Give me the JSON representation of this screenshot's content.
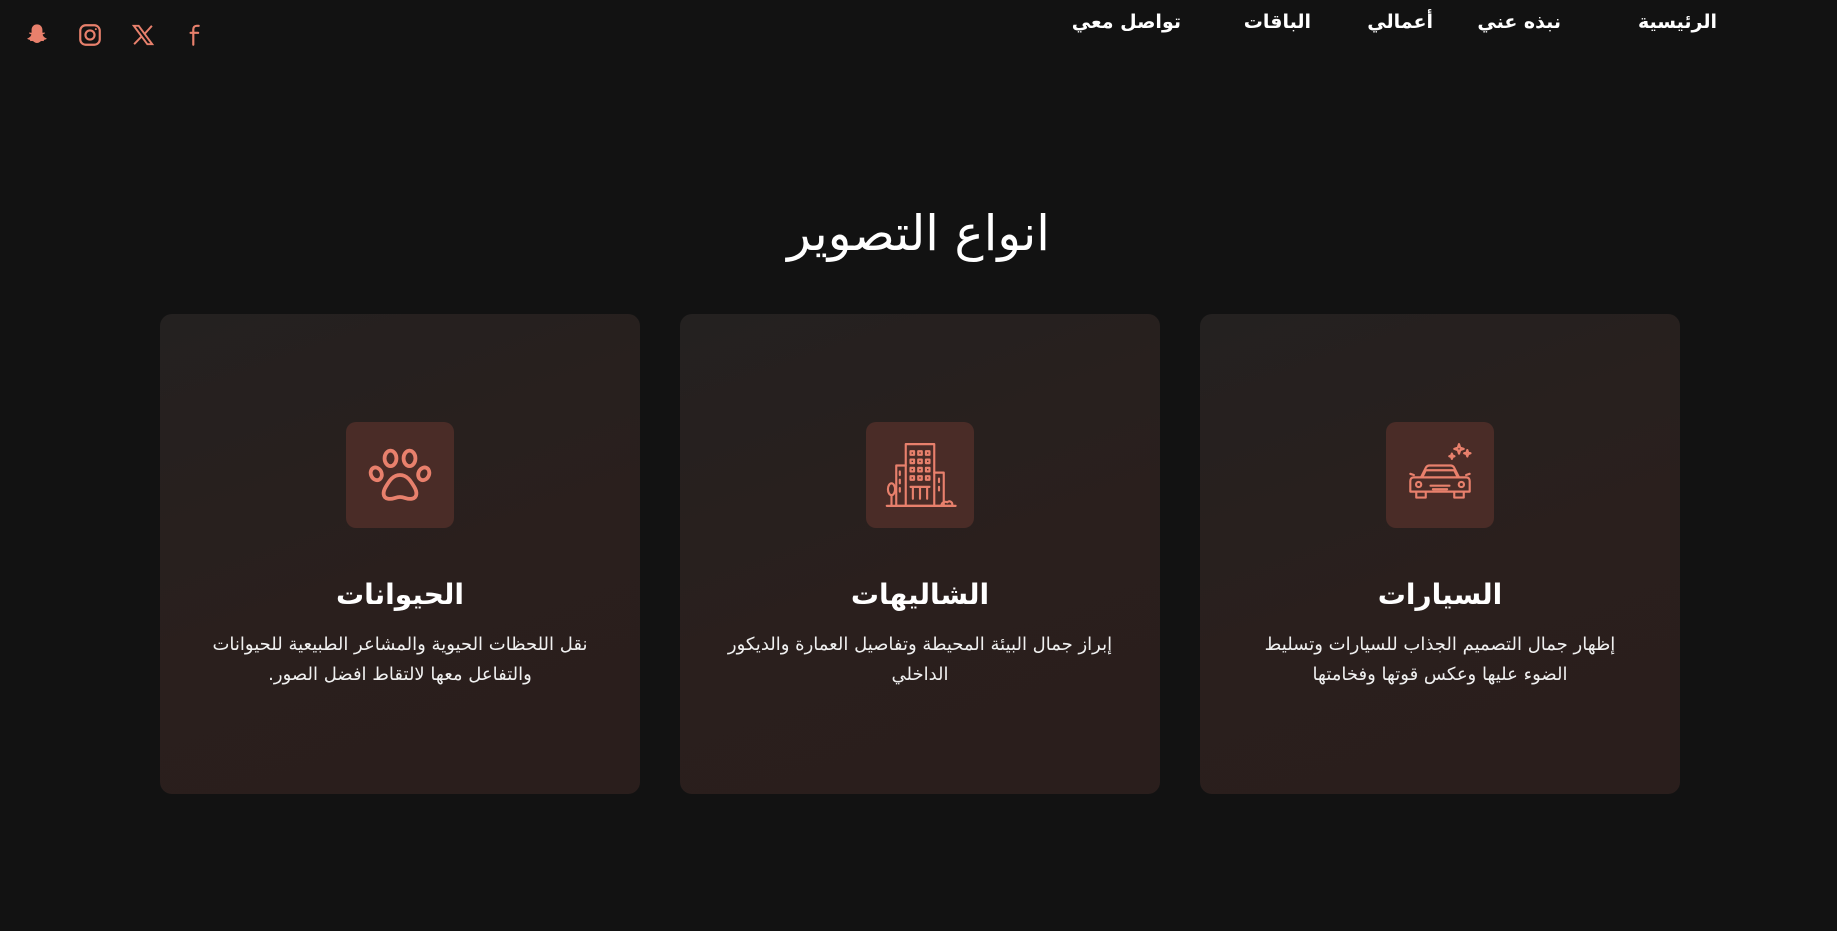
{
  "nav": {
    "items": [
      "الرئيسية",
      "نبذه عني",
      "أعمالي",
      "الباقات",
      "تواصل معي"
    ]
  },
  "socials": [
    "facebook-icon",
    "x-icon",
    "instagram-icon",
    "snapchat-icon"
  ],
  "accent_color": "#e8806c",
  "section": {
    "title": "انواع التصوير",
    "cards": [
      {
        "icon": "car-icon",
        "title": "السيارات",
        "description": "إظهار جمال التصميم الجذاب للسيارات وتسليط الضوء عليها وعكس قوتها وفخامتها"
      },
      {
        "icon": "building-icon",
        "title": "الشاليهات",
        "description": "إبراز جمال البيئة المحيطة وتفاصيل العمارة والديكور الداخلي"
      },
      {
        "icon": "paw-icon",
        "title": "الحيوانات",
        "description": "نقل اللحظات الحيوية والمشاعر الطبيعية للحيوانات والتفاعل معها لالتقاط افضل الصور."
      }
    ]
  }
}
